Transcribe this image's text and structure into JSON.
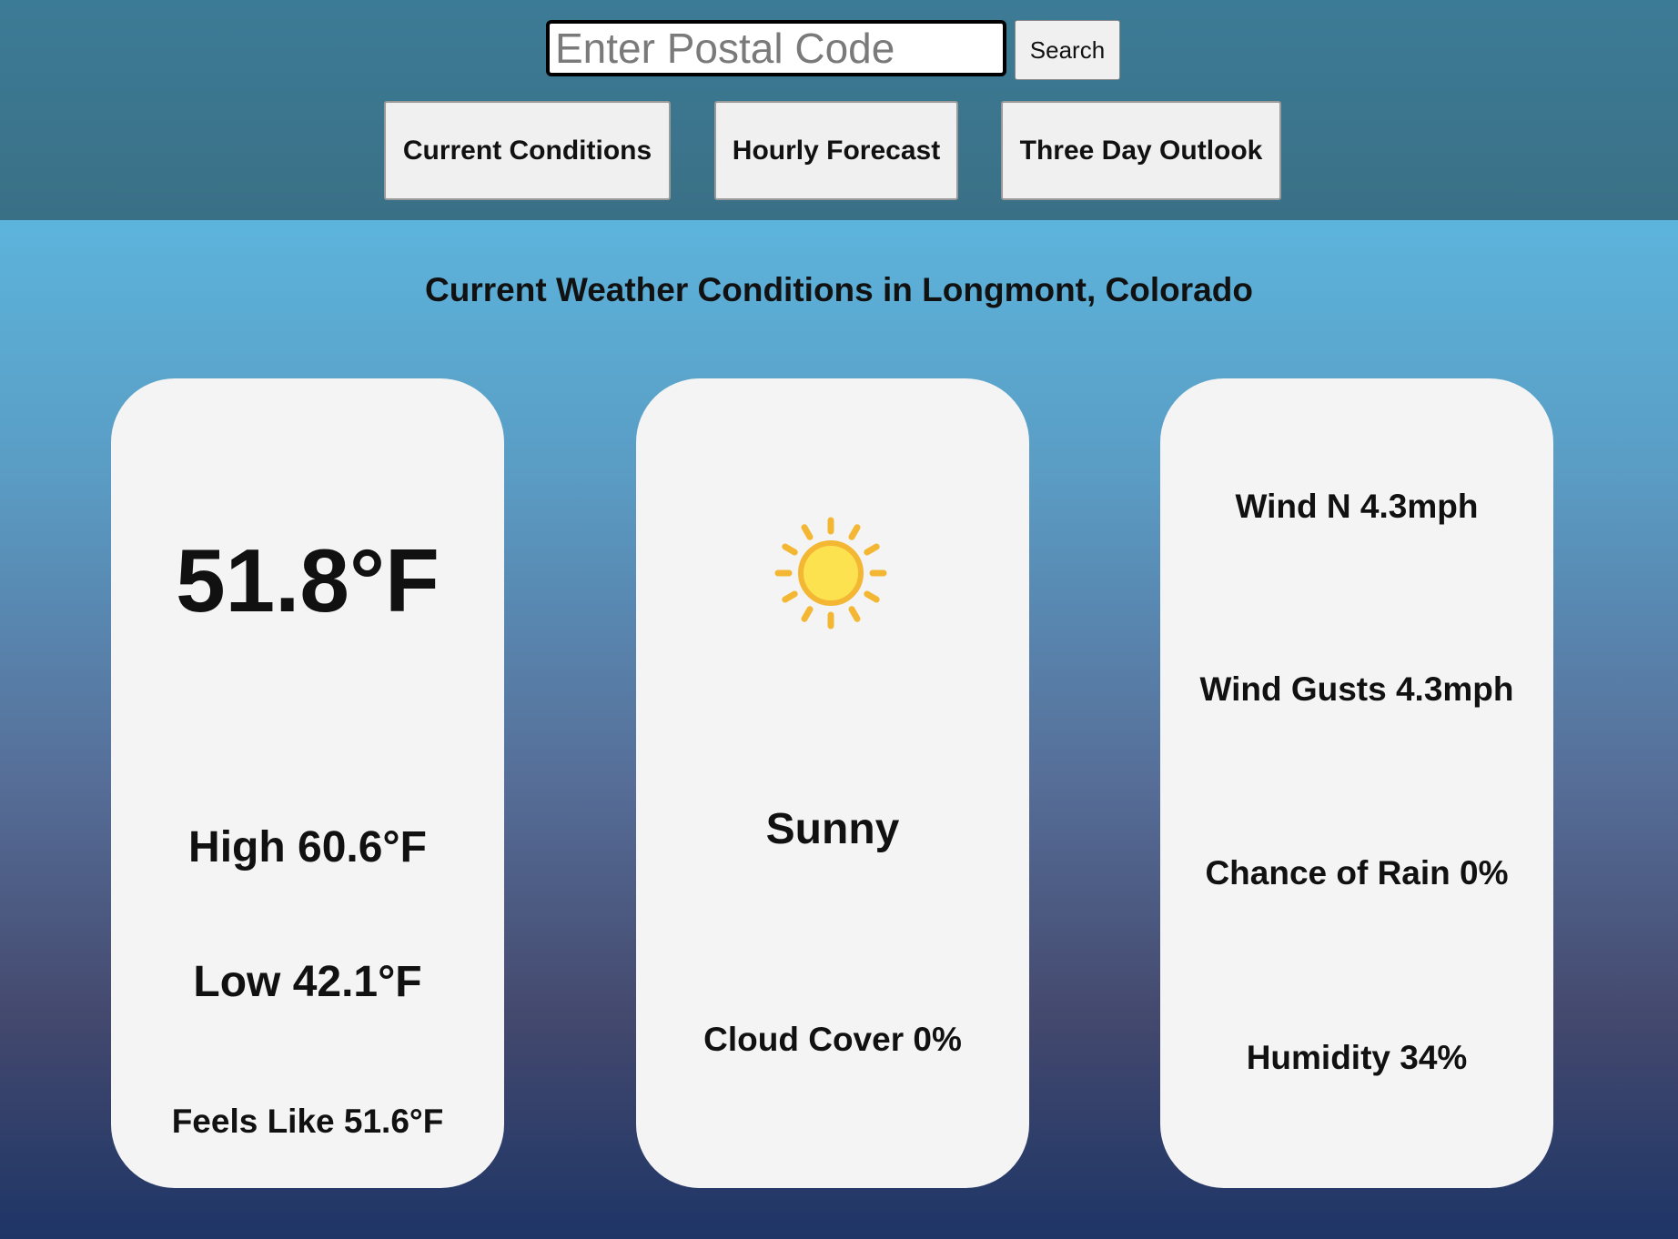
{
  "search": {
    "placeholder": "Enter Postal Code",
    "button_label": "Search"
  },
  "tabs": [
    {
      "label": "Current Conditions"
    },
    {
      "label": "Hourly Forecast"
    },
    {
      "label": "Three Day Outlook"
    }
  ],
  "heading": "Current Weather Conditions in Longmont, Colorado",
  "temperature_card": {
    "current": "51.8°F",
    "high": "High 60.6°F",
    "low": "Low 42.1°F",
    "feels_like": "Feels Like 51.6°F"
  },
  "sky_card": {
    "icon": "sun-icon",
    "condition": "Sunny",
    "cloud_cover": "Cloud Cover 0%"
  },
  "wind_card": {
    "wind": "Wind N 4.3mph",
    "gusts": "Wind Gusts 4.3mph",
    "rain": "Chance of Rain 0%",
    "humidity": "Humidity 34%"
  },
  "colors": {
    "topbar": "#3a7590",
    "gradient_top": "#5cb4dc",
    "gradient_bottom": "#1e3566",
    "card_bg": "#f4f4f4",
    "sun_core": "#fde250",
    "sun_rays": "#f3b733"
  }
}
